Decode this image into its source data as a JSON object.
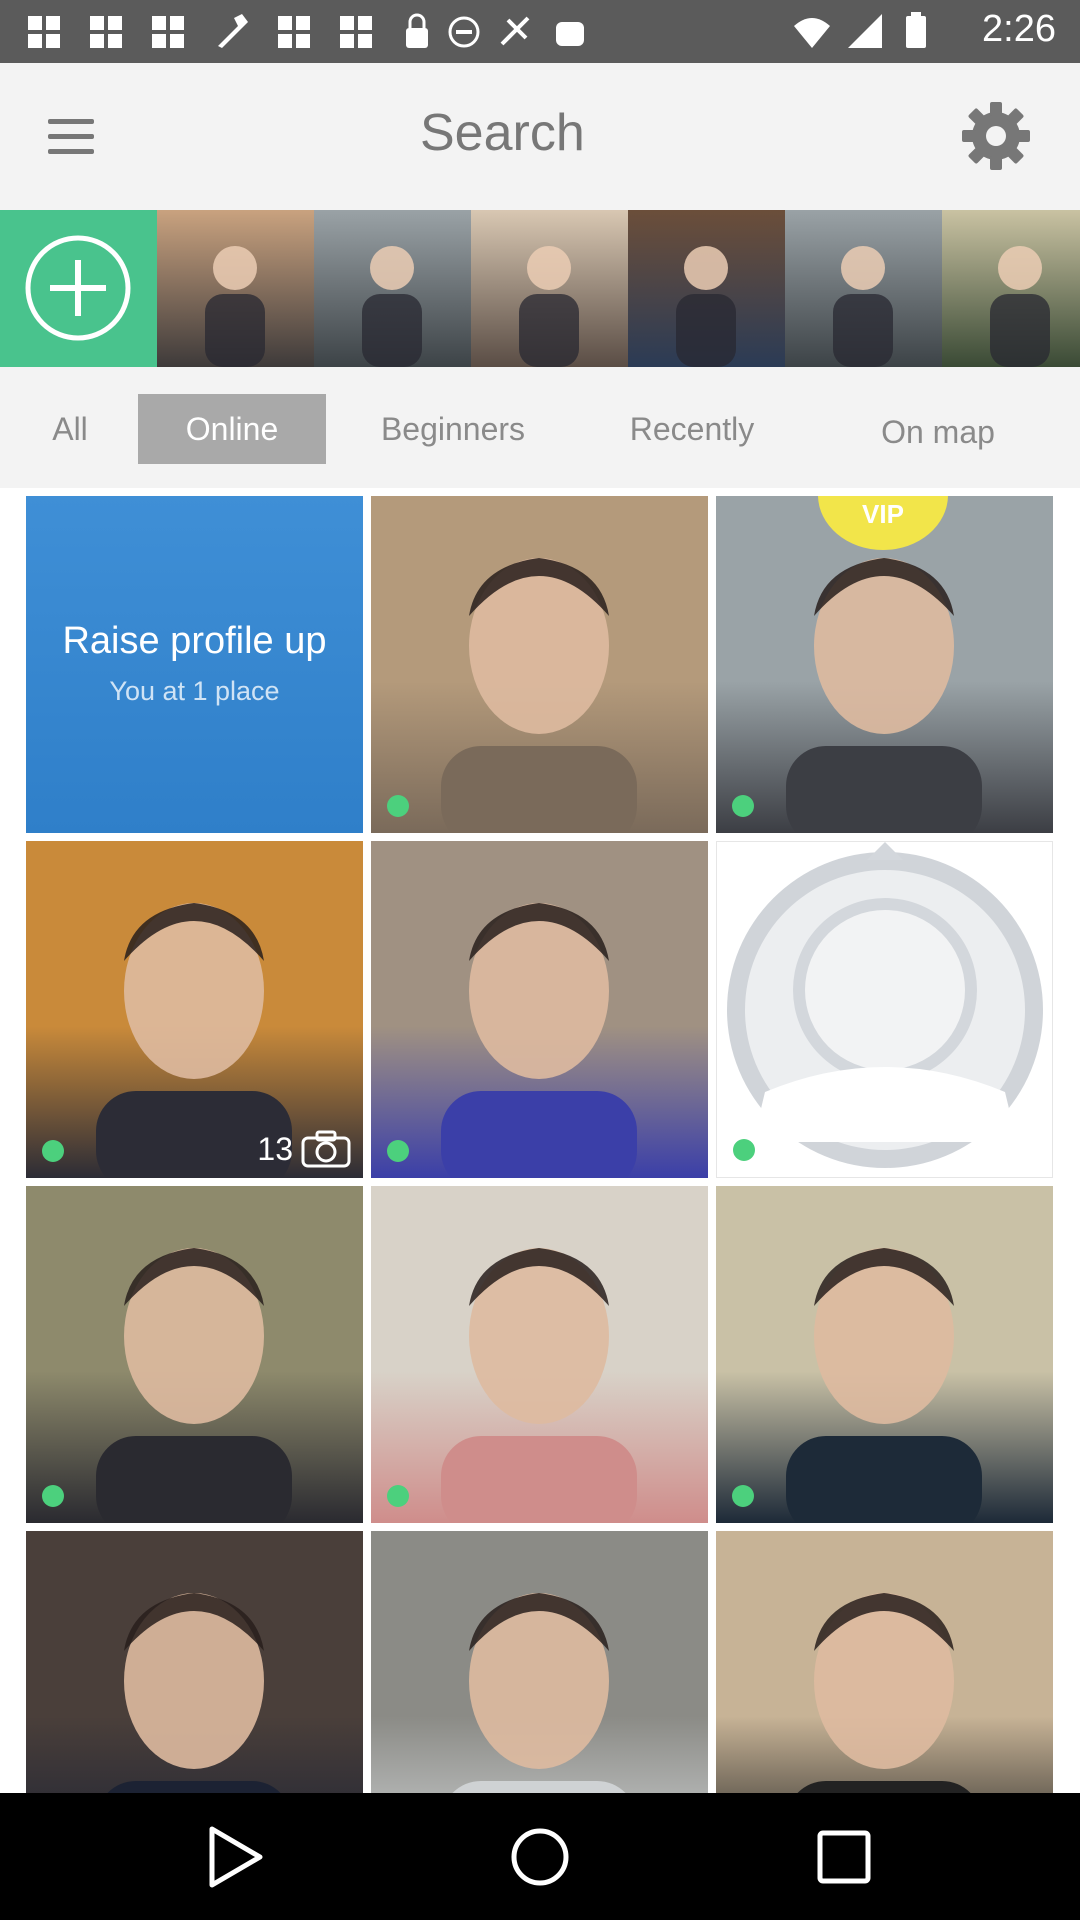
{
  "status_bar": {
    "time": "2:26",
    "notification_icons": [
      "grid-icon",
      "grid-icon",
      "grid-icon",
      "wrench-icon",
      "grid-icon",
      "grid-icon",
      "lock-icon",
      "minus-circle-icon",
      "fake-gps-icon",
      "android-icon"
    ],
    "system_icons": [
      "wifi-icon",
      "signal-icon",
      "battery-icon"
    ]
  },
  "header": {
    "title": "Search"
  },
  "stories": {
    "add_label": "",
    "items": [
      {
        "name": "story-woman-car",
        "color_a": "#c9a27f",
        "color_b": "#3e3a3a"
      },
      {
        "name": "story-man-river",
        "color_a": "#9aa2a6",
        "color_b": "#3d4347"
      },
      {
        "name": "story-woman-blonde",
        "color_a": "#d8c7b2",
        "color_b": "#5a4d45"
      },
      {
        "name": "story-man-tree",
        "color_a": "#6b4e3a",
        "color_b": "#2b3b55"
      },
      {
        "name": "story-man-river-2",
        "color_a": "#9aa2a6",
        "color_b": "#3d4347"
      },
      {
        "name": "story-man-green",
        "color_a": "#c9c2a2",
        "color_b": "#3a4a35"
      }
    ]
  },
  "tabs": [
    {
      "label": "All",
      "active": false
    },
    {
      "label": "Online",
      "active": true
    },
    {
      "label": "Beginners",
      "active": false
    },
    {
      "label": "Recently",
      "active": false
    },
    {
      "label": "On map",
      "active": false
    }
  ],
  "promo": {
    "title": "Raise profile up",
    "subtitle": "You at 1 place"
  },
  "vip_label": "VIP",
  "photo_count": "13",
  "profiles": [
    {
      "kind": "promo"
    },
    {
      "kind": "photo",
      "online": true,
      "bg": "#b49a7b",
      "fg": "#7a6a5a"
    },
    {
      "kind": "photo",
      "online": true,
      "vip": true,
      "bg": "#9aa3a7",
      "fg": "#3c3e44"
    },
    {
      "kind": "photo",
      "online": true,
      "count": true,
      "bg": "#c98a3a",
      "fg": "#2c2c36"
    },
    {
      "kind": "photo",
      "online": true,
      "bg": "#a09182",
      "fg": "#3b3fa8"
    },
    {
      "kind": "placeholder",
      "online": true
    },
    {
      "kind": "photo",
      "online": true,
      "bg": "#8e8a6c",
      "fg": "#2a2a30"
    },
    {
      "kind": "photo",
      "online": true,
      "bg": "#d8d2c8",
      "fg": "#cf8d8b"
    },
    {
      "kind": "photo",
      "online": true,
      "bg": "#c9c1a6",
      "fg": "#1d2a38"
    },
    {
      "kind": "photo",
      "online": false,
      "bg": "#4a3f3a",
      "fg": "#1c2233"
    },
    {
      "kind": "photo",
      "online": false,
      "bg": "#8b8b86",
      "fg": "#cfd2d4"
    },
    {
      "kind": "photo",
      "online": false,
      "bg": "#c7b396",
      "fg": "#222"
    }
  ]
}
